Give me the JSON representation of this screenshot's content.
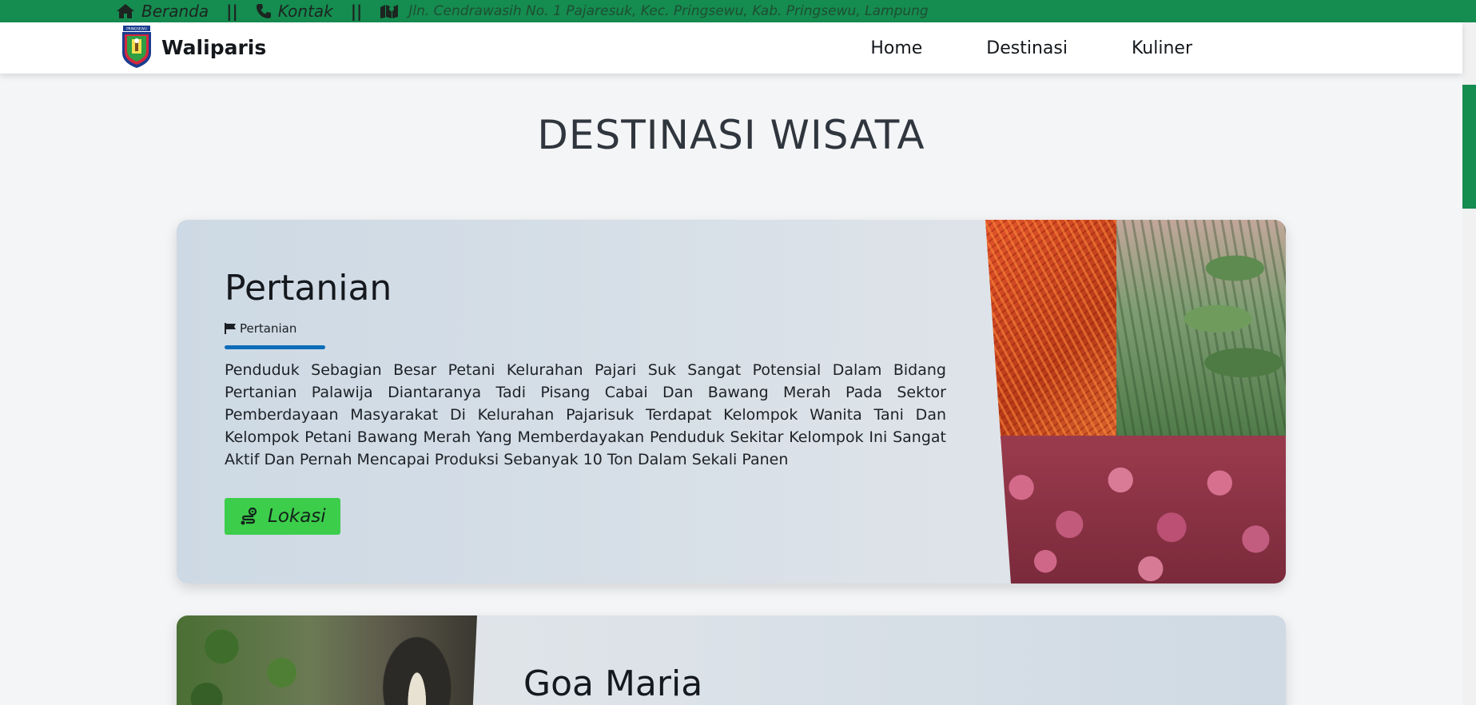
{
  "topbar": {
    "home_label": "Beranda",
    "separator": "||",
    "contact_label": "Kontak",
    "address": "Jln. Cendrawasih No. 1 Pajaresuk, Kec. Pringsewu, Kab. Pringsewu, Lampung",
    "icons": [
      "home-icon",
      "phone-icon",
      "map-icon"
    ]
  },
  "navbar": {
    "brand_name": "Waliparis",
    "brand_logo_text": "PRINGSEWU",
    "links": [
      "Home",
      "Destinasi",
      "Kuliner"
    ]
  },
  "section": {
    "title": "DESTINASI WISATA"
  },
  "cards": [
    {
      "title": "Pertanian",
      "category": "Pertanian",
      "description": "Penduduk Sebagian Besar Petani Kelurahan Pajari Suk Sangat Potensial Dalam Bidang Pertanian Palawija Diantaranya Tadi Pisang Cabai Dan Bawang Merah Pada Sektor Pemberdayaan Masyarakat Di Kelurahan Pajarisuk Terdapat Kelompok Wanita Tani Dan Kelompok Petani Bawang Merah Yang Memberdayakan Penduduk Sekitar Kelompok Ini Sangat Aktif Dan Pernah Mencapai Produksi Sebanyak 10 Ton Dalam Sekali Panen",
      "button_label": "Lokasi"
    },
    {
      "title": "Goa Maria"
    }
  ],
  "colors": {
    "topbar": "#158c50",
    "button": "#3ccd4b",
    "underline": "#0d6dba",
    "scrollbar_thumb": "#158c50"
  }
}
